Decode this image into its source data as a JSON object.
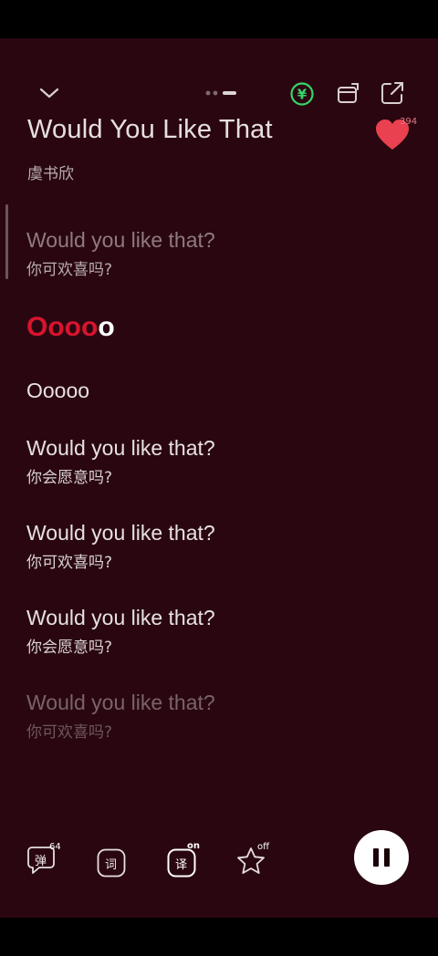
{
  "song": {
    "title": "Would You Like That",
    "artist": "虞书欣",
    "like_count": "394"
  },
  "header": {
    "icons": [
      "chevron-down-icon",
      "page-dots-icon",
      "yuan-coin-icon",
      "switch-view-icon",
      "share-icon"
    ]
  },
  "lyrics": [
    {
      "en": "Would you like that?",
      "zh": "你可欢喜吗?",
      "state": "dim"
    },
    {
      "en": "Ooooo",
      "zh": "",
      "state": "active",
      "sung": "Oooo",
      "unsung": "o"
    },
    {
      "en": "Ooooo",
      "zh": "",
      "state": "normal"
    },
    {
      "en": "Would you like that?",
      "zh": "你会愿意吗?",
      "state": "normal"
    },
    {
      "en": "Would you like that?",
      "zh": "你可欢喜吗?",
      "state": "normal"
    },
    {
      "en": "Would you like that?",
      "zh": "你会愿意吗?",
      "state": "normal"
    },
    {
      "en": "Would you like that?",
      "zh": "你可欢喜吗?",
      "state": "fade"
    }
  ],
  "toolbar": {
    "danmaku_label": "弹",
    "danmaku_count": "64",
    "lyrics_label": "词",
    "translate_label": "译",
    "translate_state": "on",
    "favorite_state": "off"
  },
  "colors": {
    "background": "#2a0710",
    "highlight": "#d8142e",
    "heart": "#e9414f",
    "coin": "#39d36a"
  }
}
